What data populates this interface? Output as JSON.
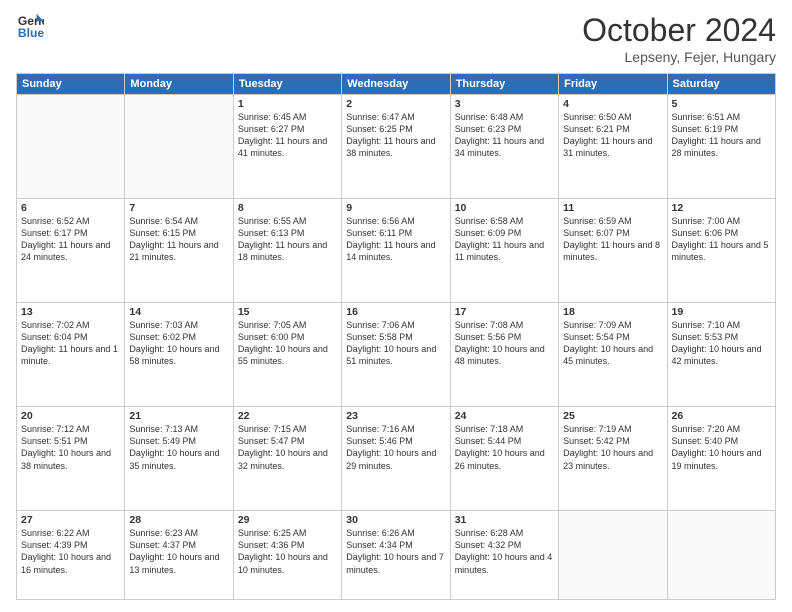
{
  "logo": {
    "general": "General",
    "blue": "Blue"
  },
  "title": "October 2024",
  "location": "Lepseny, Fejer, Hungary",
  "days_of_week": [
    "Sunday",
    "Monday",
    "Tuesday",
    "Wednesday",
    "Thursday",
    "Friday",
    "Saturday"
  ],
  "weeks": [
    [
      {
        "day": "",
        "sunrise": "",
        "sunset": "",
        "daylight": ""
      },
      {
        "day": "",
        "sunrise": "",
        "sunset": "",
        "daylight": ""
      },
      {
        "day": "1",
        "sunrise": "Sunrise: 6:45 AM",
        "sunset": "Sunset: 6:27 PM",
        "daylight": "Daylight: 11 hours and 41 minutes."
      },
      {
        "day": "2",
        "sunrise": "Sunrise: 6:47 AM",
        "sunset": "Sunset: 6:25 PM",
        "daylight": "Daylight: 11 hours and 38 minutes."
      },
      {
        "day": "3",
        "sunrise": "Sunrise: 6:48 AM",
        "sunset": "Sunset: 6:23 PM",
        "daylight": "Daylight: 11 hours and 34 minutes."
      },
      {
        "day": "4",
        "sunrise": "Sunrise: 6:50 AM",
        "sunset": "Sunset: 6:21 PM",
        "daylight": "Daylight: 11 hours and 31 minutes."
      },
      {
        "day": "5",
        "sunrise": "Sunrise: 6:51 AM",
        "sunset": "Sunset: 6:19 PM",
        "daylight": "Daylight: 11 hours and 28 minutes."
      }
    ],
    [
      {
        "day": "6",
        "sunrise": "Sunrise: 6:52 AM",
        "sunset": "Sunset: 6:17 PM",
        "daylight": "Daylight: 11 hours and 24 minutes."
      },
      {
        "day": "7",
        "sunrise": "Sunrise: 6:54 AM",
        "sunset": "Sunset: 6:15 PM",
        "daylight": "Daylight: 11 hours and 21 minutes."
      },
      {
        "day": "8",
        "sunrise": "Sunrise: 6:55 AM",
        "sunset": "Sunset: 6:13 PM",
        "daylight": "Daylight: 11 hours and 18 minutes."
      },
      {
        "day": "9",
        "sunrise": "Sunrise: 6:56 AM",
        "sunset": "Sunset: 6:11 PM",
        "daylight": "Daylight: 11 hours and 14 minutes."
      },
      {
        "day": "10",
        "sunrise": "Sunrise: 6:58 AM",
        "sunset": "Sunset: 6:09 PM",
        "daylight": "Daylight: 11 hours and 11 minutes."
      },
      {
        "day": "11",
        "sunrise": "Sunrise: 6:59 AM",
        "sunset": "Sunset: 6:07 PM",
        "daylight": "Daylight: 11 hours and 8 minutes."
      },
      {
        "day": "12",
        "sunrise": "Sunrise: 7:00 AM",
        "sunset": "Sunset: 6:06 PM",
        "daylight": "Daylight: 11 hours and 5 minutes."
      }
    ],
    [
      {
        "day": "13",
        "sunrise": "Sunrise: 7:02 AM",
        "sunset": "Sunset: 6:04 PM",
        "daylight": "Daylight: 11 hours and 1 minute."
      },
      {
        "day": "14",
        "sunrise": "Sunrise: 7:03 AM",
        "sunset": "Sunset: 6:02 PM",
        "daylight": "Daylight: 10 hours and 58 minutes."
      },
      {
        "day": "15",
        "sunrise": "Sunrise: 7:05 AM",
        "sunset": "Sunset: 6:00 PM",
        "daylight": "Daylight: 10 hours and 55 minutes."
      },
      {
        "day": "16",
        "sunrise": "Sunrise: 7:06 AM",
        "sunset": "Sunset: 5:58 PM",
        "daylight": "Daylight: 10 hours and 51 minutes."
      },
      {
        "day": "17",
        "sunrise": "Sunrise: 7:08 AM",
        "sunset": "Sunset: 5:56 PM",
        "daylight": "Daylight: 10 hours and 48 minutes."
      },
      {
        "day": "18",
        "sunrise": "Sunrise: 7:09 AM",
        "sunset": "Sunset: 5:54 PM",
        "daylight": "Daylight: 10 hours and 45 minutes."
      },
      {
        "day": "19",
        "sunrise": "Sunrise: 7:10 AM",
        "sunset": "Sunset: 5:53 PM",
        "daylight": "Daylight: 10 hours and 42 minutes."
      }
    ],
    [
      {
        "day": "20",
        "sunrise": "Sunrise: 7:12 AM",
        "sunset": "Sunset: 5:51 PM",
        "daylight": "Daylight: 10 hours and 38 minutes."
      },
      {
        "day": "21",
        "sunrise": "Sunrise: 7:13 AM",
        "sunset": "Sunset: 5:49 PM",
        "daylight": "Daylight: 10 hours and 35 minutes."
      },
      {
        "day": "22",
        "sunrise": "Sunrise: 7:15 AM",
        "sunset": "Sunset: 5:47 PM",
        "daylight": "Daylight: 10 hours and 32 minutes."
      },
      {
        "day": "23",
        "sunrise": "Sunrise: 7:16 AM",
        "sunset": "Sunset: 5:46 PM",
        "daylight": "Daylight: 10 hours and 29 minutes."
      },
      {
        "day": "24",
        "sunrise": "Sunrise: 7:18 AM",
        "sunset": "Sunset: 5:44 PM",
        "daylight": "Daylight: 10 hours and 26 minutes."
      },
      {
        "day": "25",
        "sunrise": "Sunrise: 7:19 AM",
        "sunset": "Sunset: 5:42 PM",
        "daylight": "Daylight: 10 hours and 23 minutes."
      },
      {
        "day": "26",
        "sunrise": "Sunrise: 7:20 AM",
        "sunset": "Sunset: 5:40 PM",
        "daylight": "Daylight: 10 hours and 19 minutes."
      }
    ],
    [
      {
        "day": "27",
        "sunrise": "Sunrise: 6:22 AM",
        "sunset": "Sunset: 4:39 PM",
        "daylight": "Daylight: 10 hours and 16 minutes."
      },
      {
        "day": "28",
        "sunrise": "Sunrise: 6:23 AM",
        "sunset": "Sunset: 4:37 PM",
        "daylight": "Daylight: 10 hours and 13 minutes."
      },
      {
        "day": "29",
        "sunrise": "Sunrise: 6:25 AM",
        "sunset": "Sunset: 4:36 PM",
        "daylight": "Daylight: 10 hours and 10 minutes."
      },
      {
        "day": "30",
        "sunrise": "Sunrise: 6:26 AM",
        "sunset": "Sunset: 4:34 PM",
        "daylight": "Daylight: 10 hours and 7 minutes."
      },
      {
        "day": "31",
        "sunrise": "Sunrise: 6:28 AM",
        "sunset": "Sunset: 4:32 PM",
        "daylight": "Daylight: 10 hours and 4 minutes."
      },
      {
        "day": "",
        "sunrise": "",
        "sunset": "",
        "daylight": ""
      },
      {
        "day": "",
        "sunrise": "",
        "sunset": "",
        "daylight": ""
      }
    ]
  ]
}
